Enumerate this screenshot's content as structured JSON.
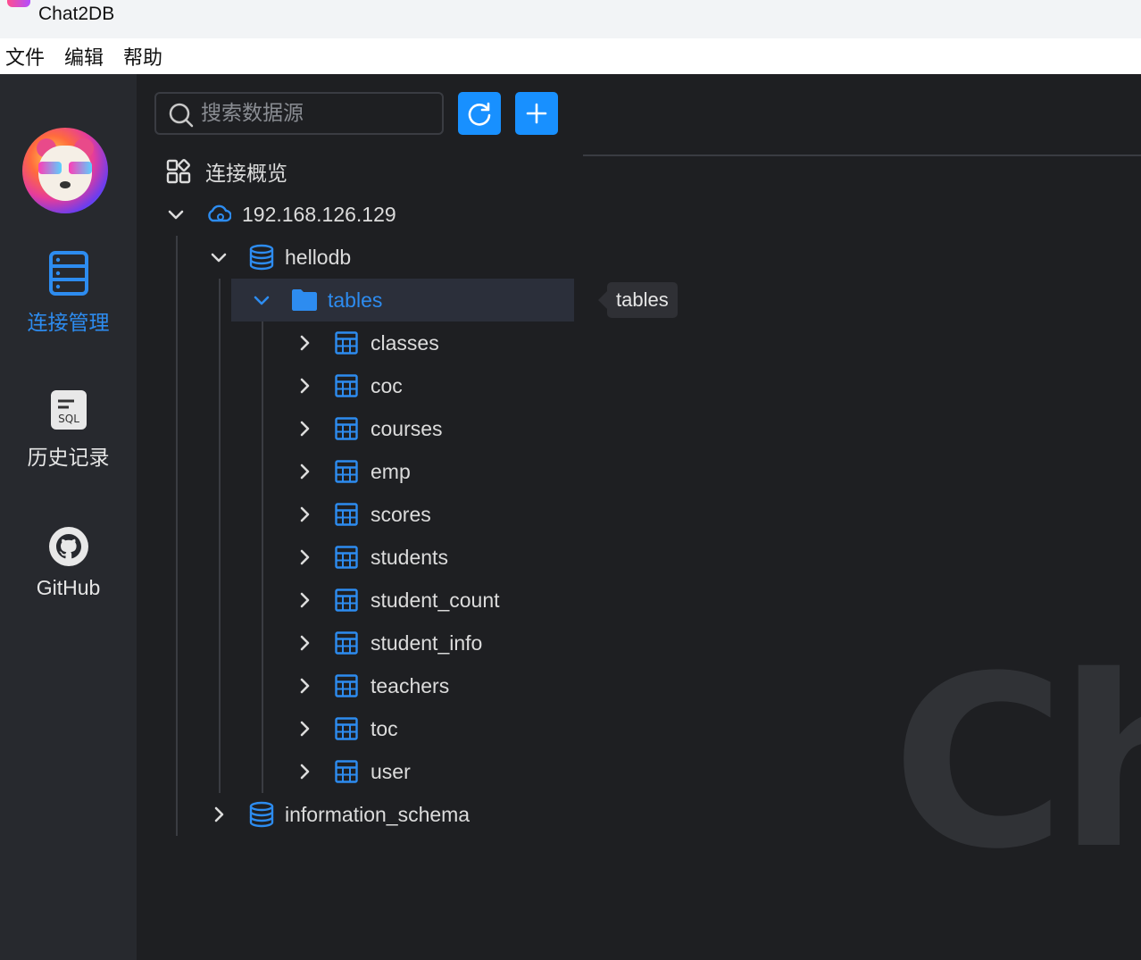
{
  "window": {
    "title": "Chat2DB"
  },
  "menu": {
    "items": [
      "文件",
      "编辑",
      "帮助"
    ]
  },
  "nav": {
    "items": [
      {
        "label": "连接管理",
        "icon": "database-server-icon",
        "active": true
      },
      {
        "label": "历史记录",
        "icon": "sql-history-icon",
        "active": false
      },
      {
        "label": "GitHub",
        "icon": "github-icon",
        "active": false
      }
    ]
  },
  "tree": {
    "search_placeholder": "搜索数据源",
    "overview_label": "连接概览",
    "connection": "192.168.126.129",
    "database": "hellodb",
    "folder": "tables",
    "tables": [
      "classes",
      "coc",
      "courses",
      "emp",
      "scores",
      "students",
      "student_count",
      "student_info",
      "teachers",
      "toc",
      "user"
    ],
    "other_database": "information_schema"
  },
  "tooltip": {
    "text": "tables"
  },
  "watermark": {
    "text": "Ch"
  },
  "colors": {
    "accent": "#1890ff",
    "selected_text": "#2d8cf0",
    "background": "#1e1f22",
    "nav_bg": "#27292e"
  }
}
